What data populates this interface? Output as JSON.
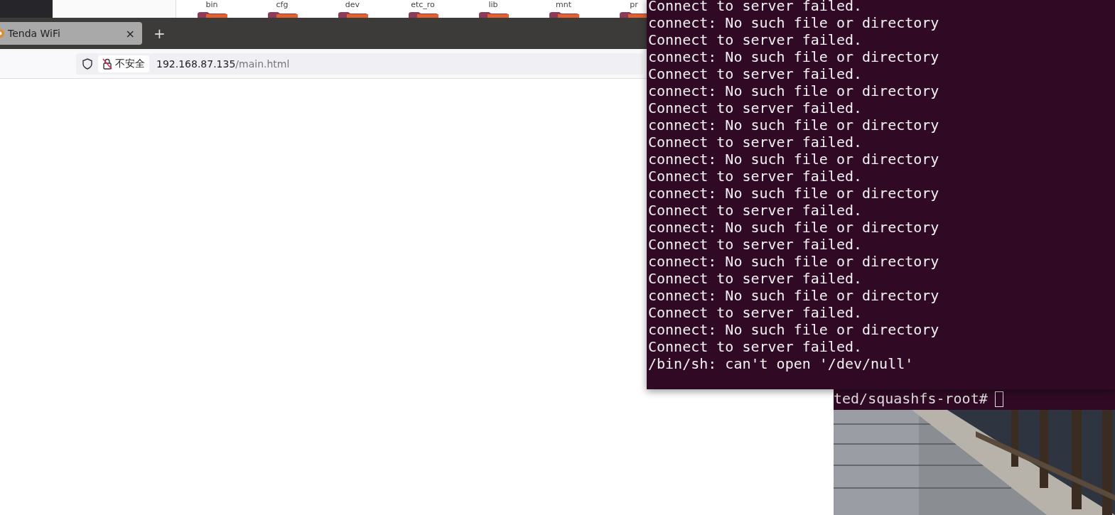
{
  "file_manager": {
    "folders": [
      {
        "name": "bin"
      },
      {
        "name": "cfg"
      },
      {
        "name": "dev"
      },
      {
        "name": "etc_ro"
      },
      {
        "name": "lib"
      },
      {
        "name": "mnt"
      },
      {
        "name": "pr"
      }
    ]
  },
  "browser": {
    "tabs": [
      {
        "title": "Tenda WiFi",
        "selected": true
      }
    ],
    "new_tab": "+",
    "close": "×",
    "address_bar": {
      "security_label": "不安全",
      "host": "192.168.87.135",
      "path": "/main.html"
    }
  },
  "terminal_front": {
    "lines": [
      "Connect to server failed.",
      "connect: No such file or directory",
      "Connect to server failed.",
      "connect: No such file or directory",
      "Connect to server failed.",
      "connect: No such file or directory",
      "Connect to server failed.",
      "connect: No such file or directory",
      "Connect to server failed.",
      "connect: No such file or directory",
      "Connect to server failed.",
      "connect: No such file or directory",
      "Connect to server failed.",
      "connect: No such file or directory",
      "Connect to server failed.",
      "connect: No such file or directory",
      "Connect to server failed.",
      "connect: No such file or directory",
      "Connect to server failed.",
      "connect: No such file or directory",
      "Connect to server failed.",
      "/bin/sh: can't open '/dev/null'"
    ]
  },
  "terminal_back": {
    "prompt": "ted/squashfs-root#"
  }
}
